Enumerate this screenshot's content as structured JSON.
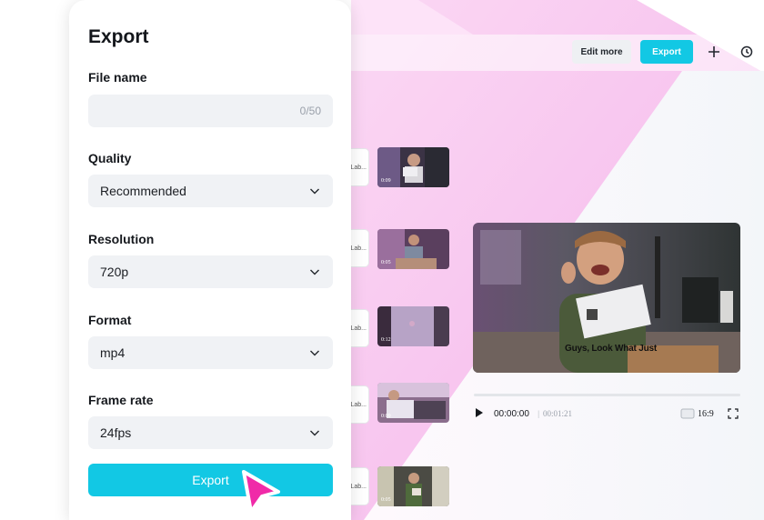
{
  "toolbar": {
    "edit_more_label": "Edit more",
    "export_label": "Export",
    "add_icon": "plus-icon",
    "history_icon": "clock-icon"
  },
  "scenes": [
    {
      "label": "Lab...",
      "time": "0:09"
    },
    {
      "label": "Lab...",
      "time": "0:05"
    },
    {
      "label": "Lab...",
      "time": "0:12"
    },
    {
      "label": "Lab...",
      "time": "0:09"
    },
    {
      "label": "Lab...",
      "time": "0:05"
    }
  ],
  "preview": {
    "caption": "Guys, Look What Just",
    "current_time": "00:00:00",
    "total_time": "00:01:21",
    "aspect_ratio": "16:9"
  },
  "export_panel": {
    "title": "Export",
    "file_name": {
      "label": "File name",
      "value": "",
      "counter": "0/50"
    },
    "quality": {
      "label": "Quality",
      "value": "Recommended"
    },
    "resolution": {
      "label": "Resolution",
      "value": "720p"
    },
    "format": {
      "label": "Format",
      "value": "mp4"
    },
    "frame_rate": {
      "label": "Frame rate",
      "value": "24fps"
    },
    "export_button_label": "Export"
  },
  "colors": {
    "accent": "#12c8e4",
    "cursor": "#f02aa8",
    "background_pink": "#f9c9f0"
  }
}
